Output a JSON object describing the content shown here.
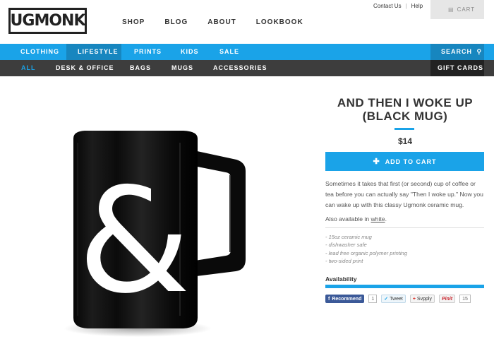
{
  "header": {
    "logo_text": "UGMONK",
    "nav": [
      "SHOP",
      "BLOG",
      "ABOUT",
      "LOOKBOOK"
    ],
    "top_links": [
      "Contact Us",
      "Help"
    ],
    "cart_label": "CART",
    "cart_icon": "cart-icon"
  },
  "category_bar": {
    "items": [
      "CLOTHING",
      "LIFESTYLE",
      "PRINTS",
      "KIDS",
      "SALE"
    ],
    "active": "LIFESTYLE",
    "search_label": "SEARCH",
    "search_icon": "search-icon"
  },
  "sub_bar": {
    "items": [
      "ALL",
      "DESK & OFFICE",
      "BAGS",
      "MUGS",
      "ACCESSORIES"
    ],
    "selected": "ALL",
    "gift_cards": "GIFT CARDS"
  },
  "product": {
    "title_line1": "AND THEN I WOKE UP",
    "title_line2": "(BLACK MUG)",
    "price": "$14",
    "add_to_cart": "ADD TO CART",
    "description": "Sometimes it takes that first (or second) cup of coffee or tea before you can actually say \"Then I woke up.\" Now you can wake up with this classy Ugmonk ceramic mug.",
    "also_available_prefix": "Also available in ",
    "also_available_link": "white",
    "also_available_suffix": ".",
    "features": [
      "- 15oz ceramic mug",
      "- dishwasher safe",
      "- lead free organic polymer printing",
      "- two-sided print"
    ],
    "mug_glyph": "&",
    "availability_label": "Availability"
  },
  "social": {
    "facebook": "Recommend",
    "facebook_count": "1",
    "twitter": "Tweet",
    "svpply": "Svpply",
    "pinterest": "Pinit",
    "pinterest_count": "15"
  },
  "colors": {
    "accent": "#1aa3e8",
    "dark_bar": "#3d3d3d"
  }
}
